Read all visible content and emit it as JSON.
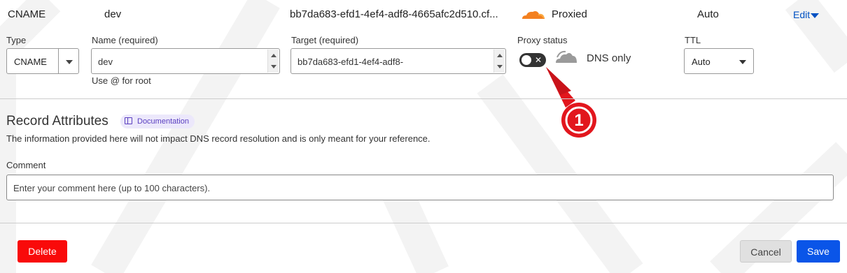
{
  "record_summary": {
    "type": "CNAME",
    "name": "dev",
    "target": "bb7da683-efd1-4ef4-adf8-4665afc2d510.cf...",
    "proxy_status": "Proxied",
    "ttl": "Auto",
    "edit_label": "Edit"
  },
  "form": {
    "type_label": "Type",
    "type_value": "CNAME",
    "name_label": "Name (required)",
    "name_value": "dev",
    "name_hint": "Use @ for root",
    "target_label": "Target (required)",
    "target_value": "bb7da683-efd1-4ef4-adf8-",
    "proxy_label": "Proxy status",
    "proxy_value": "DNS only",
    "ttl_label": "TTL",
    "ttl_value": "Auto"
  },
  "annotation": {
    "number": "1"
  },
  "attributes": {
    "title": "Record Attributes",
    "doc_badge": "Documentation",
    "description": "The information provided here will not impact DNS record resolution and is only meant for your reference.",
    "comment_label": "Comment",
    "comment_placeholder": "Enter your comment here (up to 100 characters)."
  },
  "actions": {
    "delete": "Delete",
    "cancel": "Cancel",
    "save": "Save"
  },
  "colors": {
    "proxied_cloud": "#f38020",
    "dns_only_cloud": "#8a8a8a",
    "annotation_red": "#e2161d",
    "delete_btn": "#f90a0a",
    "save_btn": "#0a55e8",
    "link": "#0051c3"
  }
}
